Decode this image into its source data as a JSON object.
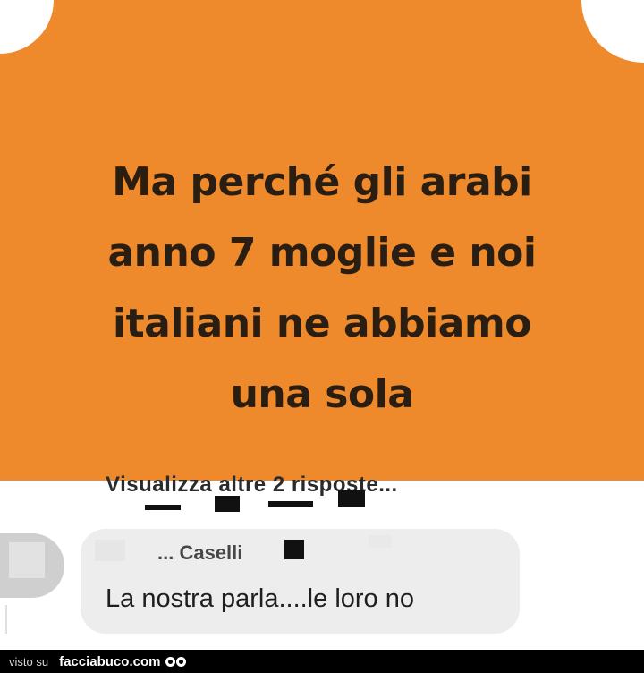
{
  "post": {
    "lines": [
      "Ma perché gli arabi",
      "anno 7 moglie e noi",
      "italiani ne abbiamo",
      "una sola"
    ],
    "background_color": "#ee8a2c"
  },
  "replies": {
    "view_more_label": "Visualizza altre 2 risposte..."
  },
  "comment": {
    "author": "... Caselli",
    "text": "La nostra parla....le loro no"
  },
  "footer": {
    "visto_label": "visto su",
    "site_label": "facciabuco.com",
    "logo_icon": "eyes-icon"
  }
}
